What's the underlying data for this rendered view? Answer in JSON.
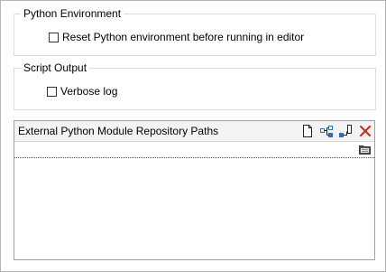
{
  "python_environment": {
    "title": "Python Environment",
    "reset_label": "Reset Python environment before running in editor",
    "reset_checked": false
  },
  "script_output": {
    "title": "Script Output",
    "verbose_label": "Verbose log",
    "verbose_checked": false
  },
  "repository_paths": {
    "title": "External Python Module Repository Paths",
    "toolbar": {
      "new_icon": "new-document-icon",
      "add_tree_icon": "add-node-icon",
      "insert_icon": "insert-node-icon",
      "delete_icon": "delete-x-icon"
    },
    "browse_icon": "folder-browse-icon",
    "rows": [
      ""
    ]
  },
  "colors": {
    "delete": "#c42b1c",
    "accent": "#2f6fb5"
  }
}
